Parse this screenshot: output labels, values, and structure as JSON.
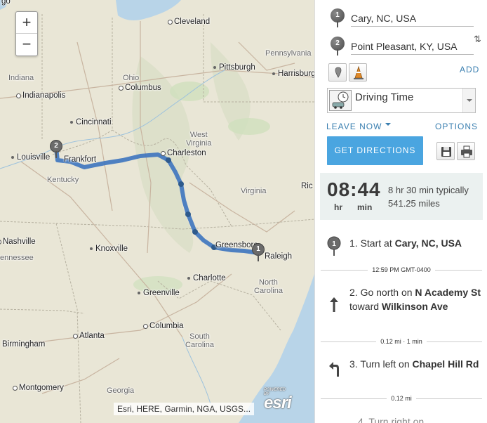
{
  "map": {
    "zoom_in": "+",
    "zoom_out": "−",
    "attribution": "Esri, HERE, Garmin, NGA, USGS...",
    "logo_text": "esri",
    "logo_powered": "POWERED BY",
    "cities": {
      "cleveland": "Cleveland",
      "pennsylvania": "Pennsylvania",
      "indiana": "Indiana",
      "ohio": "Ohio",
      "pittsburgh": "Pittsburgh",
      "harrisburg": "Harrisburg",
      "indianapolis": "Indianapolis",
      "columbus": "Columbus",
      "cincinnati": "Cincinnati",
      "west_virginia": "West\nVirginia",
      "louisville": "Louisville",
      "frankfort": "Frankfort",
      "charleston": "Charleston",
      "kentucky": "Kentucky",
      "virginia": "Virginia",
      "richmond": "Ric",
      "nashville": "Nashville",
      "tennessee": "ennessee",
      "knoxville": "Knoxville",
      "greensboro": "Greensboro",
      "raleigh": "Raleigh",
      "charlotte": "Charlotte",
      "north_carolina": "North\nCarolina",
      "greenville": "Greenville",
      "columbia": "Columbia",
      "birmingham": "Birmingham",
      "atlanta": "Atlanta",
      "south_carolina": "South\nCarolina",
      "montgomery": "Montgomery",
      "georgia": "Georgia",
      "chicago_frag": "go"
    },
    "pin_start": "1",
    "pin_end": "2"
  },
  "panel": {
    "stops": [
      {
        "num": "1",
        "value": "Cary, NC, USA"
      },
      {
        "num": "2",
        "value": "Point Pleasant, KY, USA"
      }
    ],
    "swap_icon": "⇅",
    "add_label": "ADD",
    "mode": {
      "label": "Driving Time",
      "icon": "clock-car-icon"
    },
    "leave_now": "LEAVE NOW",
    "options": "OPTIONS",
    "get_directions": "GET DIRECTIONS",
    "summary": {
      "hours": "08",
      "colon": ":",
      "minutes": "44",
      "hr_unit": "hr",
      "min_unit": "min",
      "line1": "8 hr 30 min typically",
      "line2": "541.25 miles"
    },
    "steps": [
      {
        "num": "1.",
        "pre": "Start at ",
        "bold": "Cary, NC, USA",
        "mid": "",
        "bold2": ""
      },
      {
        "num": "2.",
        "pre": "Go north on ",
        "bold": "N Academy St",
        "mid": " toward ",
        "bold2": "Wilkinson Ave"
      },
      {
        "num": "3.",
        "pre": "Turn left on ",
        "bold": "Chapel Hill Rd",
        "mid": "",
        "bold2": ""
      }
    ],
    "separators": [
      "12:59 PM GMT-0400",
      "0.12 mi · 1 min",
      "0.12 mi"
    ],
    "step4_partial": "4. Turn right on ...",
    "colors": {
      "accent": "#4aa5e0",
      "link": "#3a7fb0",
      "route": "#3d74bf"
    }
  }
}
